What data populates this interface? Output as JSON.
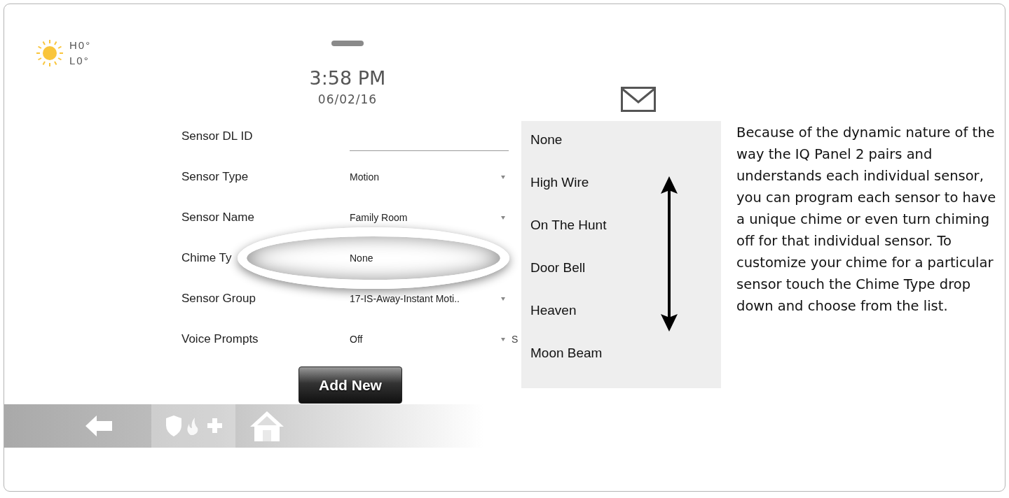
{
  "weather": {
    "high": "H0°",
    "low": "L0°"
  },
  "clock": {
    "time": "3:58 PM",
    "date": "06/02/16"
  },
  "form": {
    "rows": [
      {
        "kind": "text-input",
        "label": "Sensor DL ID",
        "highlighted": false
      },
      {
        "kind": "dropdown",
        "label": "Sensor Type",
        "value": "Motion",
        "highlighted": false
      },
      {
        "kind": "dropdown",
        "label": "Sensor Name",
        "value": "Family Room",
        "highlighted": false
      },
      {
        "kind": "dropdown",
        "label": "Chime Ty",
        "value": "None",
        "highlighted": true
      },
      {
        "kind": "dropdown",
        "label": "Sensor Group",
        "value": "17-IS-Away-Instant Moti..",
        "highlighted": false
      },
      {
        "kind": "dropdown",
        "label": "Voice Prompts",
        "value": "Off",
        "trailing": "S",
        "highlighted": false
      }
    ],
    "button": "Add New"
  },
  "nav": [
    {
      "kind": "back",
      "selected": false
    },
    {
      "kind": "security",
      "selected": true
    },
    {
      "kind": "home",
      "selected": false
    }
  ],
  "chime_options": [
    "None",
    "High Wire",
    "On The Hunt",
    "Door Bell",
    "Heaven",
    "Moon Beam"
  ],
  "note": "Because of the dynamic nature of the way the IQ Panel 2 pairs and understands each individual sensor, you can program each sensor to have a unique chime or even turn chiming off for that individual sensor.  To customize your chime for a particular sensor touch the Chime Type drop down and choose from the list."
}
